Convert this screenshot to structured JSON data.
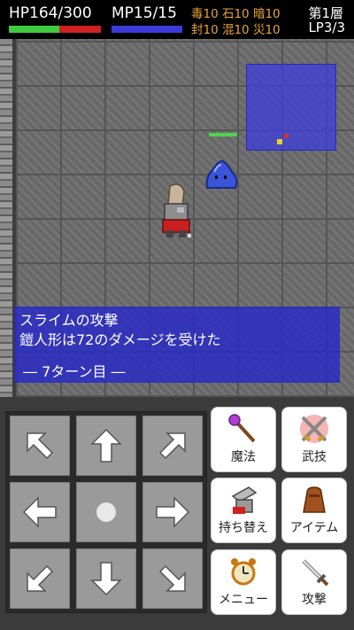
{
  "hud": {
    "hp_text": "HP164/300",
    "hp_ratio": 0.547,
    "mp_text": "MP15/15",
    "mp_ratio": 1.0,
    "status_row1": "毒10 石10 暗10",
    "status_row2": "封10 混10 災10",
    "floor": "第1層",
    "lp": "LP3/3"
  },
  "message": {
    "line1": "スライムの攻撃",
    "line2": "鎧人形は72のダメージを受けた",
    "turn": "― 7ターン目 ―"
  },
  "dpad": [
    "arrow-up-left",
    "arrow-up",
    "arrow-up-right",
    "arrow-left",
    "wait",
    "arrow-right",
    "arrow-down-left",
    "arrow-down",
    "arrow-down-right"
  ],
  "actions": {
    "magic": "魔法",
    "skill": "武技",
    "switch": "持ち替え",
    "item": "アイテム",
    "menu": "メニュー",
    "attack": "攻撃"
  },
  "colors": {
    "hp_green": "#3fcb3f",
    "hp_red": "#d02020",
    "mp_blue": "#3b3bd8",
    "status_orange": "#e8a43a",
    "message_bg": "#2828c8"
  }
}
